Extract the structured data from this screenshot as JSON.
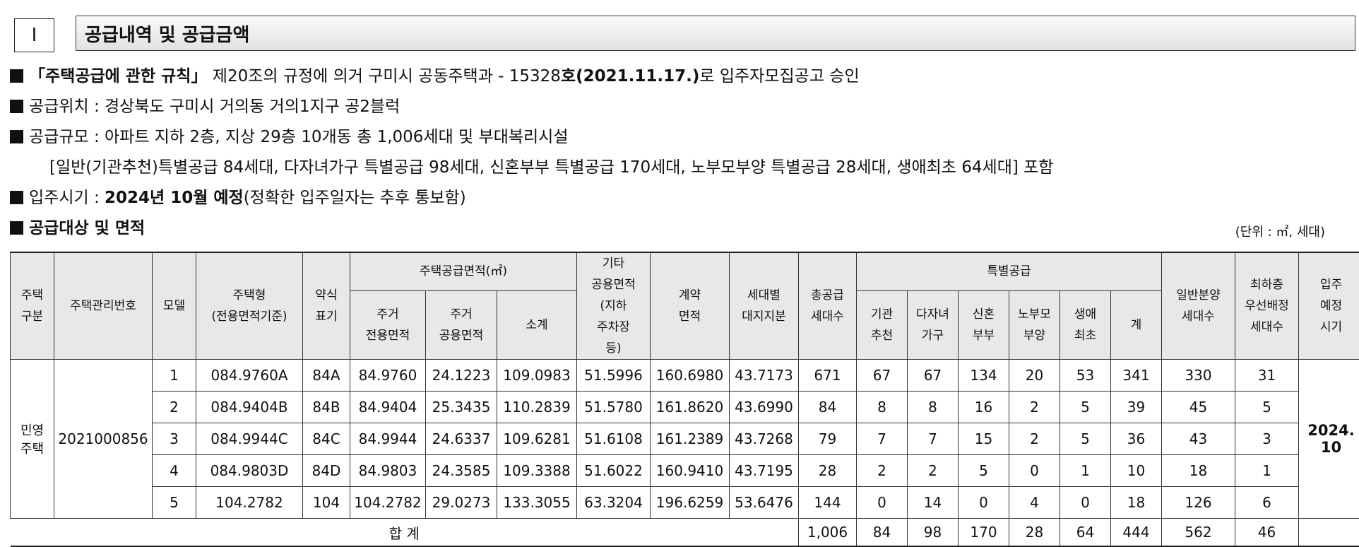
{
  "section": {
    "number": "Ⅰ",
    "title": "공급내역 및 공급금액"
  },
  "bullets": {
    "b1": {
      "bold1": "「주택공급에 관한 규칙」",
      "text1": " 제20조의 규정에 의거 구미시 공동주택과 - 15328",
      "bold2": "호(2021.11.17.)",
      "text2": "로 입주자모집공고 승인"
    },
    "b2": {
      "text": "공급위치 : 경상북도 구미시 거의동 거의1지구 공2블럭"
    },
    "b3": {
      "text": "공급규모 : 아파트 지하 2층, 지상 29층 10개동 총 1,006세대 및 부대복리시설"
    },
    "b3b": {
      "text": "[일반(기관추천)특별공급 84세대, 다자녀가구 특별공급 98세대, 신혼부부 특별공급 170세대, 노부모부양 특별공급 28세대, 생애최초 64세대] 포함"
    },
    "b4": {
      "text1": "입주시기 : ",
      "bold": "2024년 10월 예정",
      "text2": "(정확한 입주일자는 추후 통보함)"
    },
    "b5": {
      "bold": "공급대상 및 면적"
    }
  },
  "unit_note": "(단위 : ㎡, 세대)",
  "table": {
    "headers": {
      "type": "주택\n구분",
      "manage_no": "주택관리번호",
      "model": "모델",
      "housing_type": "주택형\n(전용면적기준)",
      "short": "약식\n표기",
      "supply_area": "주택공급면적(㎡)",
      "excl": "주거\n전용면적",
      "common": "주거\n공용면적",
      "subtotal": "소계",
      "other_common": "기타\n공용면적\n(지하\n주차장\n등)",
      "contract": "계약\n면적",
      "land": "세대별\n대지지분",
      "total_supply": "총공급\n세대수",
      "special": "특별공급",
      "sp_inst": "기관\n추천",
      "sp_multi": "다자녀\n가구",
      "sp_newly": "신혼\n부부",
      "sp_parent": "노부모\n부양",
      "sp_first": "생애\n최초",
      "sp_sum": "계",
      "general": "일반분양\n세대수",
      "lowest": "최하층\n우선배정\n세대수",
      "movein": "입주\n예정\n시기"
    },
    "type_value": "민영\n주택",
    "manage_no_value": "2021000856",
    "movein_value": "2024.\n10",
    "rows": [
      [
        "1",
        "084.9760A",
        "84A",
        "84.9760",
        "24.1223",
        "109.0983",
        "51.5996",
        "160.6980",
        "43.7173",
        "671",
        "67",
        "67",
        "134",
        "20",
        "53",
        "341",
        "330",
        "31"
      ],
      [
        "2",
        "084.9404B",
        "84B",
        "84.9404",
        "25.3435",
        "110.2839",
        "51.5780",
        "161.8620",
        "43.6990",
        "84",
        "8",
        "8",
        "16",
        "2",
        "5",
        "39",
        "45",
        "5"
      ],
      [
        "3",
        "084.9944C",
        "84C",
        "84.9944",
        "24.6337",
        "109.6281",
        "51.6108",
        "161.2389",
        "43.7268",
        "79",
        "7",
        "7",
        "15",
        "2",
        "5",
        "36",
        "43",
        "3"
      ],
      [
        "4",
        "084.9803D",
        "84D",
        "84.9803",
        "24.3585",
        "109.3388",
        "51.6022",
        "160.9410",
        "43.7195",
        "28",
        "2",
        "2",
        "5",
        "0",
        "1",
        "10",
        "18",
        "1"
      ],
      [
        "5",
        "104.2782",
        "104",
        "104.2782",
        "29.0273",
        "133.3055",
        "63.3204",
        "196.6259",
        "53.6476",
        "144",
        "0",
        "14",
        "0",
        "4",
        "0",
        "18",
        "126",
        "6"
      ]
    ],
    "total": {
      "label": "합 계",
      "values": [
        "1,006",
        "84",
        "98",
        "170",
        "28",
        "64",
        "444",
        "562",
        "46"
      ]
    }
  }
}
